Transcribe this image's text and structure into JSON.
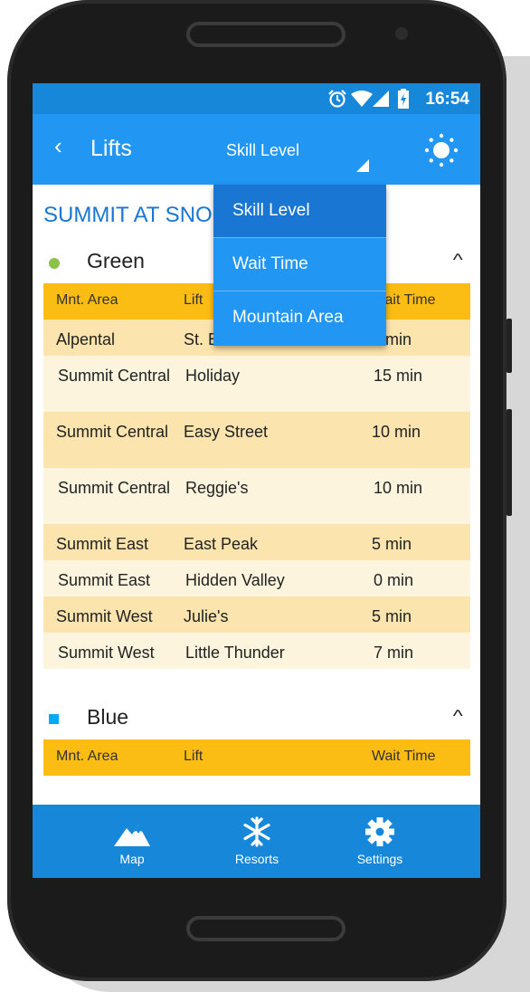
{
  "status": {
    "time": "16:54"
  },
  "appbar": {
    "back": "‹",
    "title": "Lifts",
    "sort_label": "Skill Level"
  },
  "resort_title": "SUMMIT AT SNOQUALMIE",
  "dropdown": {
    "options": [
      "Skill Level",
      "Wait Time",
      "Mountain Area"
    ],
    "selected": "Skill Level"
  },
  "table_headers": {
    "area": "Mnt. Area",
    "lift": "Lift",
    "wait": "Wait Time"
  },
  "sections": [
    {
      "name": "Green",
      "color": "#8bc34a",
      "rows": [
        {
          "area": "Alpental",
          "lift": "St. Bernard",
          "wait": "5 min"
        },
        {
          "area": "Summit Central",
          "lift": "Holiday",
          "wait": "15 min"
        },
        {
          "area": "Summit Central",
          "lift": "Easy Street",
          "wait": "10 min"
        },
        {
          "area": "Summit Central",
          "lift": "Reggie's",
          "wait": "10 min"
        },
        {
          "area": "Summit East",
          "lift": "East Peak",
          "wait": "5 min"
        },
        {
          "area": "Summit East",
          "lift": "Hidden Valley",
          "wait": "0 min"
        },
        {
          "area": "Summit West",
          "lift": "Julie's",
          "wait": "5 min"
        },
        {
          "area": "Summit West",
          "lift": "Little Thunder",
          "wait": "7 min"
        }
      ]
    },
    {
      "name": "Blue",
      "color": "#03a9f4",
      "rows": []
    }
  ],
  "nav": {
    "map": "Map",
    "resorts": "Resorts",
    "settings": "Settings"
  },
  "colors": {
    "appbar": "#2196f3",
    "statusbar": "#1787d9",
    "header_row": "#fbbc14",
    "row_dark": "#fbe4ad",
    "row_light": "#fdf4dd"
  }
}
